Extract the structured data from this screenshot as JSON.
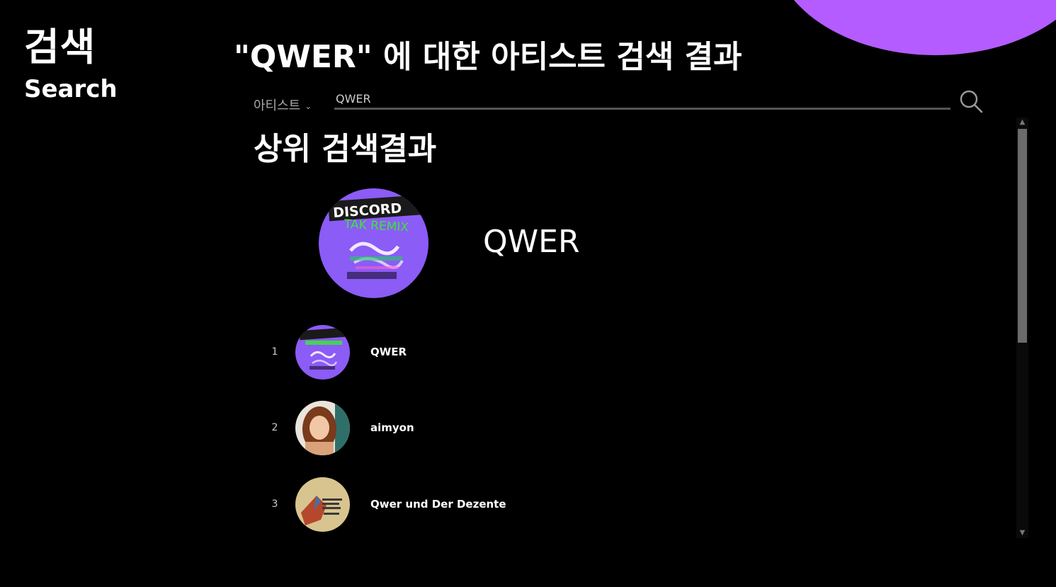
{
  "sidebar": {
    "title_ko": "검색",
    "title_en": "Search"
  },
  "header": {
    "heading": "\"QWER\" 에 대한 아티스트 검색 결과"
  },
  "search": {
    "type_label": "아티스트",
    "query": "QWER",
    "icon": "search-icon"
  },
  "top_result": {
    "heading": "상위 검색결과",
    "name": "QWER",
    "artwork_text_1": "DISCORD",
    "artwork_text_2": "TAK REMIX"
  },
  "results": [
    {
      "rank": "1",
      "name": "QWER"
    },
    {
      "rank": "2",
      "name": "aimyon"
    },
    {
      "rank": "3",
      "name": "Qwer und Der Dezente"
    }
  ],
  "colors": {
    "background": "#000000",
    "accent": "#b45cff",
    "artwork_purple": "#8b5cf6",
    "artwork_green": "#39e639"
  }
}
